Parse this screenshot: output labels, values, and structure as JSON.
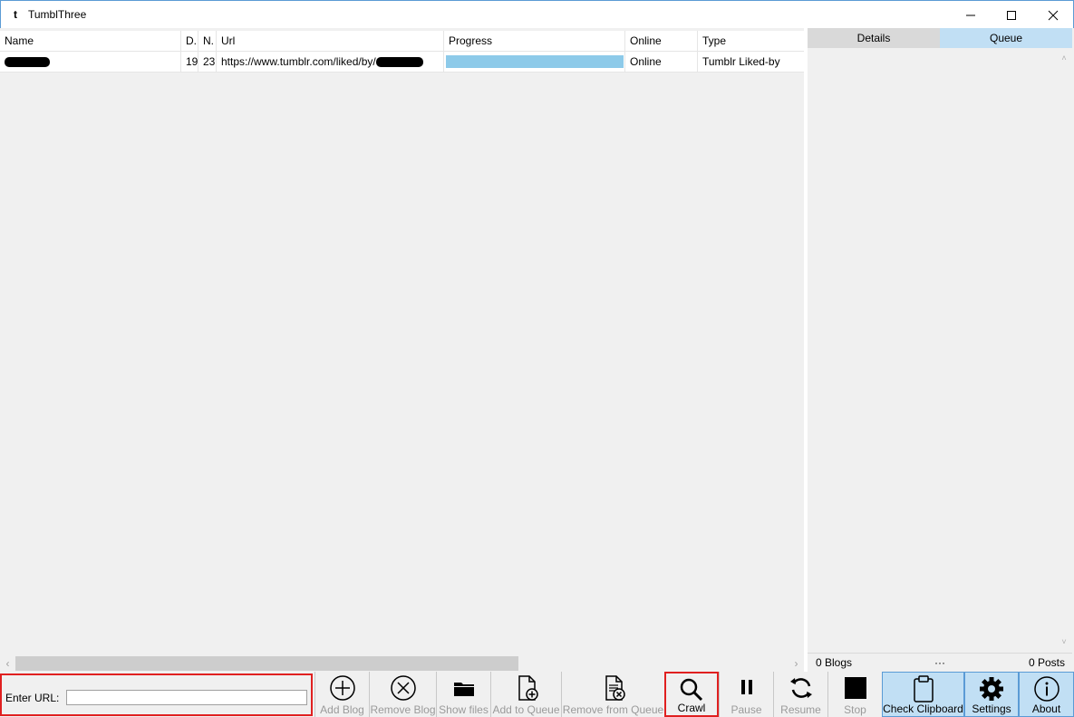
{
  "window": {
    "title": "TumblThree",
    "app_icon_glyph": "t"
  },
  "table": {
    "columns": [
      "Name",
      "D.",
      "N.",
      "Url",
      "Progress",
      "Online",
      "Type"
    ],
    "rows": [
      {
        "downloaded": "19",
        "number": "23",
        "url": "https://www.tumblr.com/liked/by/",
        "progress_fraction": 1.0,
        "online": "Online",
        "type": "Tumblr Liked-by"
      }
    ]
  },
  "scroll": {
    "left_arrow": "‹",
    "right_arrow": "›",
    "up_arrow": "˄",
    "down_arrow": "˅"
  },
  "side_panel": {
    "tabs": [
      {
        "label": "Details",
        "selected": false
      },
      {
        "label": "Queue",
        "selected": true
      }
    ],
    "status": {
      "blogs": "0 Blogs",
      "ellipsis": "···",
      "posts": "0 Posts"
    }
  },
  "url_entry": {
    "label": "Enter URL:",
    "value": "",
    "placeholder": ""
  },
  "toolbar": {
    "add_blog": "Add Blog",
    "remove_blog": "Remove Blog",
    "show_files": "Show files",
    "add_to_queue": "Add to Queue",
    "remove_from_queue": "Remove from Queue",
    "crawl": "Crawl",
    "pause": "Pause",
    "resume": "Resume",
    "stop": "Stop",
    "check_clipboard": "Check Clipboard",
    "settings": "Settings",
    "about": "About"
  },
  "colors": {
    "accent": "#5b9bd5",
    "progress": "#8dcae9",
    "selected_tab": "#c1dff4",
    "highlight_frame": "#e02020"
  }
}
